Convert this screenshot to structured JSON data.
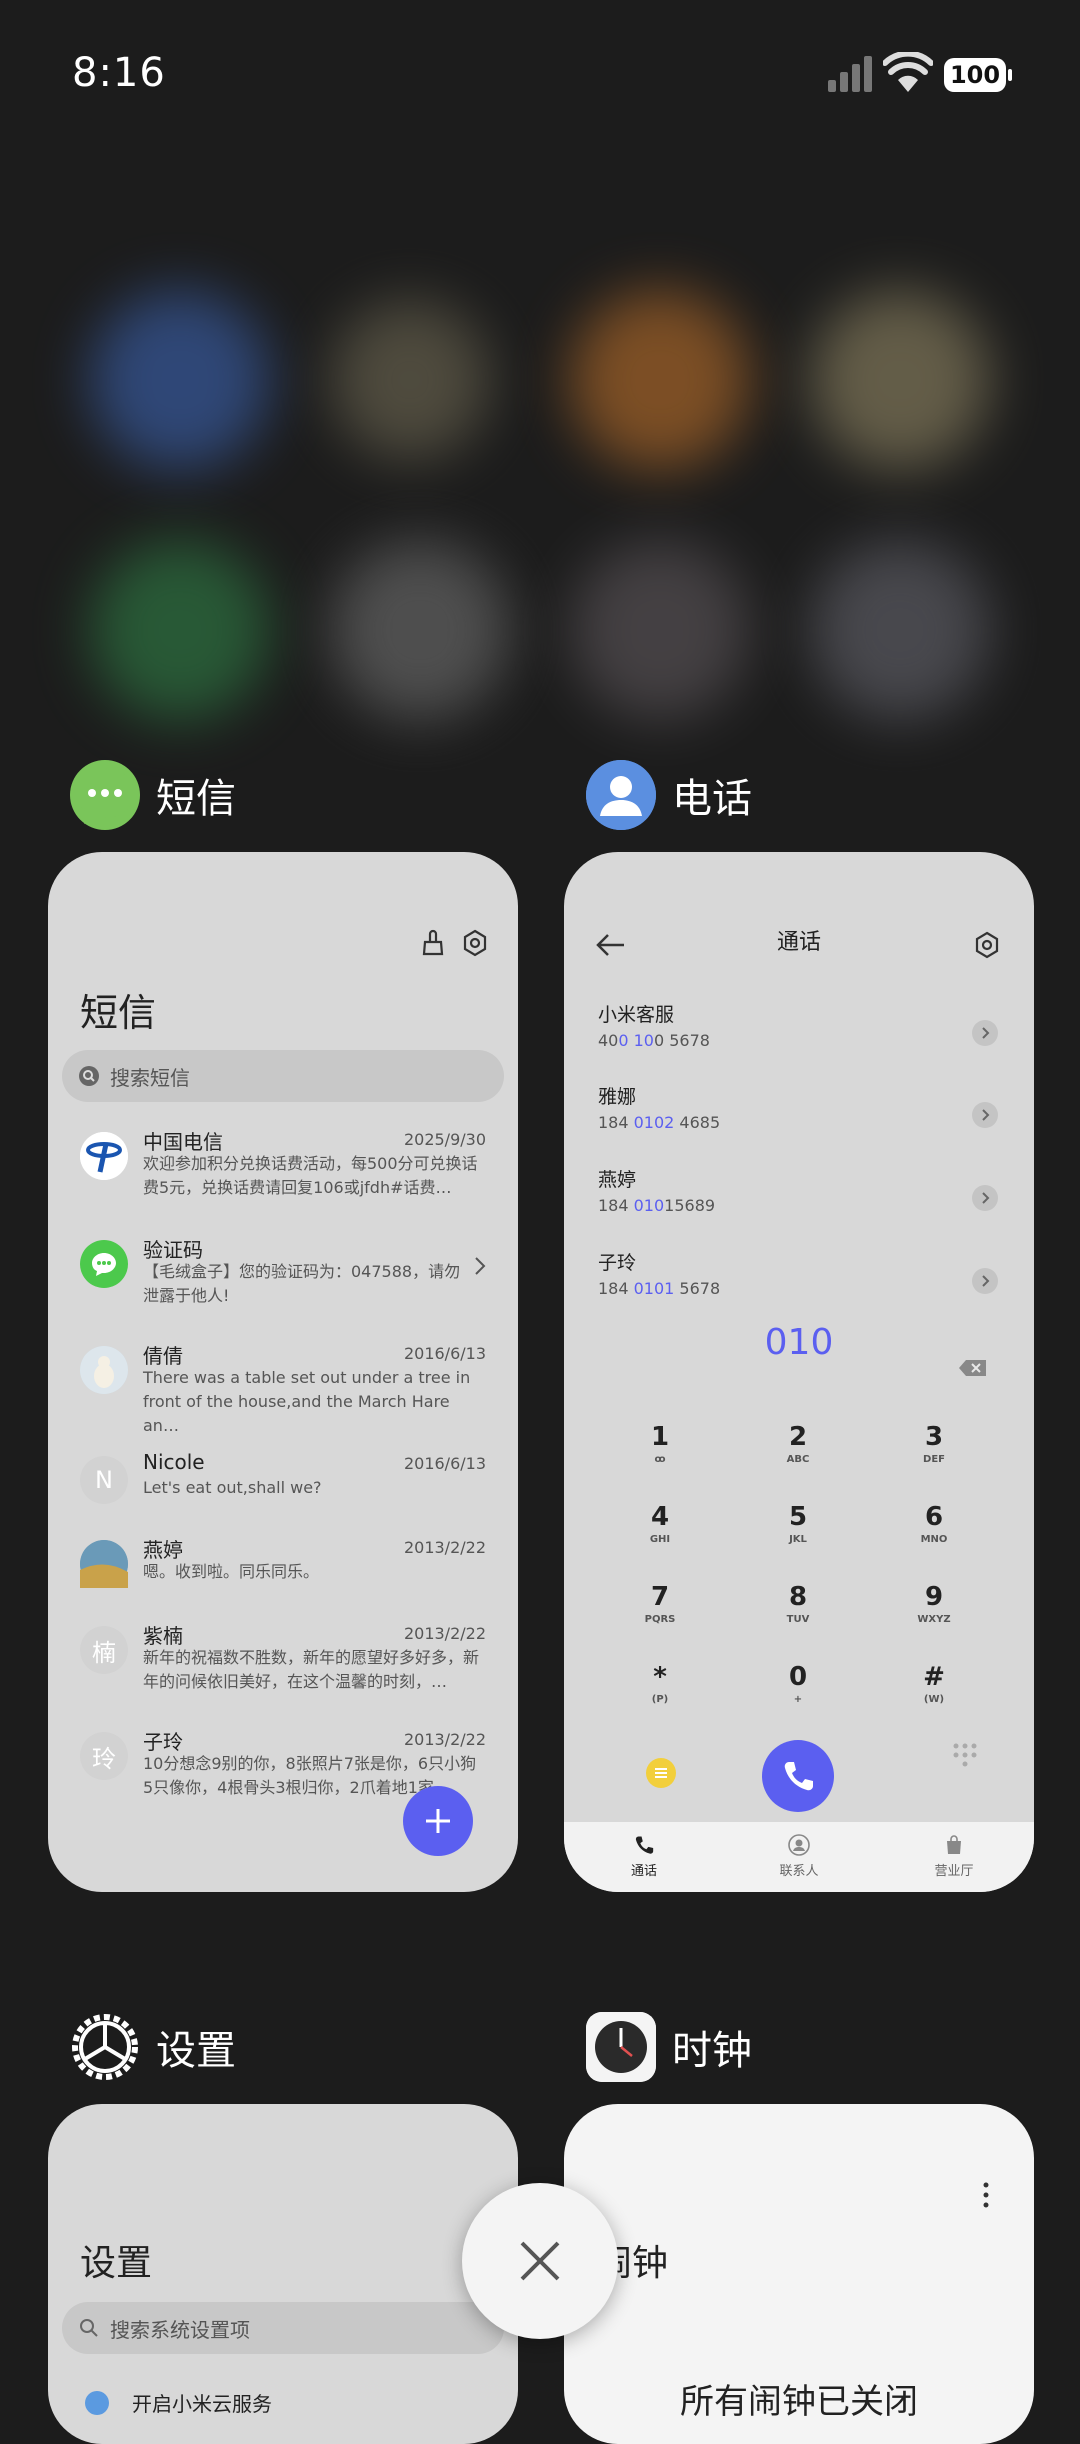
{
  "status_bar": {
    "time": "8:16",
    "battery": "100"
  },
  "apps": {
    "messages": {
      "label": "短信"
    },
    "phone": {
      "label": "电话"
    },
    "settings": {
      "label": "设置"
    },
    "clock": {
      "label": "时钟"
    }
  },
  "messages_card": {
    "title": "短信",
    "search_placeholder": "搜索短信",
    "conversations": [
      {
        "name": "中国电信",
        "date": "2025/9/30",
        "preview": "欢迎参加积分兑换话费活动，每500分可兑换话费5元，兑换话费请回复106或jfdh#话费…",
        "avatar_color": "#ffffff"
      },
      {
        "name": "验证码",
        "date": "",
        "preview": "【毛绒盒子】您的验证码为：047588，请勿泄露于他人!",
        "avatar_color": "#4cc94c"
      },
      {
        "name": "倩倩",
        "date": "2016/6/13",
        "preview": "There was a table set out under a tree in front of the house,and the March Hare an…",
        "avatar_color": "#c8d6de"
      },
      {
        "name": "Nicole",
        "date": "2016/6/13",
        "preview": "Let's eat out,shall we?",
        "avatar_initial": "N",
        "avatar_color": "#d2d2d2"
      },
      {
        "name": "燕婷",
        "date": "2013/2/22",
        "preview": "嗯。收到啦。同乐同乐。",
        "avatar_color": "#7da4b8"
      },
      {
        "name": "紫楠",
        "date": "2013/2/22",
        "preview": "新年的祝福数不胜数，新年的愿望好多好多，新年的问候依旧美好，在这个温馨的时刻，…",
        "avatar_initial": "楠",
        "avatar_color": "#d2d2d2"
      },
      {
        "name": "子玲",
        "date": "2013/2/22",
        "preview": "10分想念9别的你，8张照片7张是你，6只小狗5只像你，4根骨头3根归你，2爪着地1家…",
        "avatar_initial": "玲",
        "avatar_color": "#d2d2d2"
      }
    ]
  },
  "phone_card": {
    "title": "通话",
    "contacts": [
      {
        "name": "小米客服",
        "num_pre": "40",
        "num_hl": "0 10",
        "num_post": "0 5678"
      },
      {
        "name": "雅娜",
        "num_pre": "184 ",
        "num_hl": "0102",
        "num_post": " 4685"
      },
      {
        "name": "燕婷",
        "num_pre": "184 ",
        "num_hl": "010",
        "num_post": "15689"
      },
      {
        "name": "子玲",
        "num_pre": "184 ",
        "num_hl": "0101",
        "num_post": " 5678"
      }
    ],
    "dialed": "010",
    "keys": [
      {
        "num": "1",
        "sub": "ꝏ"
      },
      {
        "num": "2",
        "sub": "ABC"
      },
      {
        "num": "3",
        "sub": "DEF"
      },
      {
        "num": "4",
        "sub": "GHI"
      },
      {
        "num": "5",
        "sub": "JKL"
      },
      {
        "num": "6",
        "sub": "MNO"
      },
      {
        "num": "7",
        "sub": "PQRS"
      },
      {
        "num": "8",
        "sub": "TUV"
      },
      {
        "num": "9",
        "sub": "WXYZ"
      },
      {
        "num": "*",
        "sub": "(P)"
      },
      {
        "num": "0",
        "sub": "+"
      },
      {
        "num": "#",
        "sub": "(W)"
      }
    ],
    "nav": {
      "calls": "通话",
      "contacts": "联系人",
      "store": "营业厅"
    }
  },
  "settings_card": {
    "title": "设置",
    "search_placeholder": "搜索系统设置项",
    "first_item": "开启小米云服务"
  },
  "clock_card": {
    "title": "闹钟",
    "status": "所有闹钟已关闭"
  },
  "colors": {
    "accent": "#5b5ff0"
  }
}
